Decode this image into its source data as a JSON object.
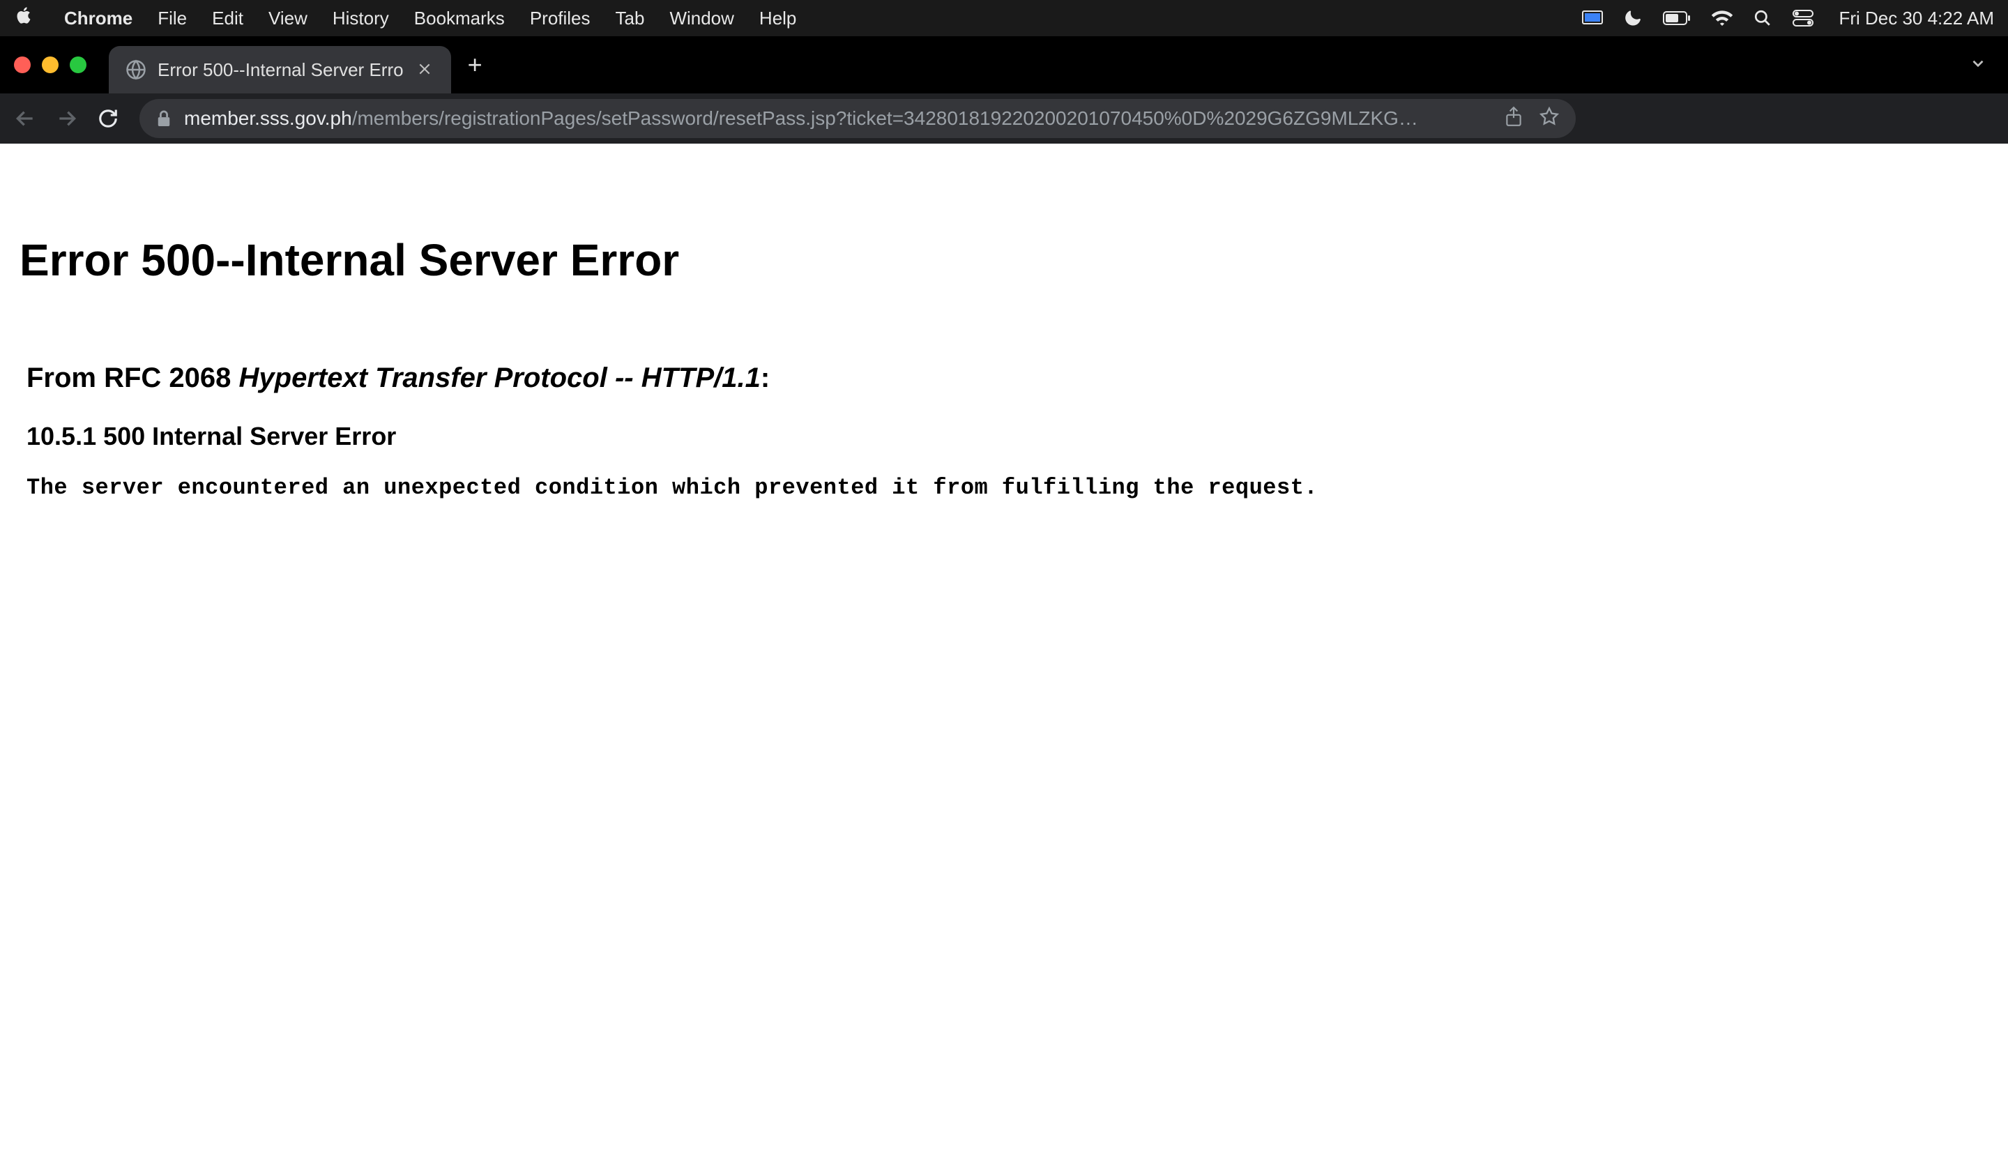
{
  "menubar": {
    "app_name": "Chrome",
    "items": [
      "File",
      "Edit",
      "View",
      "History",
      "Bookmarks",
      "Profiles",
      "Tab",
      "Window",
      "Help"
    ],
    "clock": "Fri Dec 30  4:22 AM"
  },
  "tab": {
    "title": "Error 500--Internal Server Erro"
  },
  "omnibox": {
    "domain": "member.sss.gov.ph",
    "path": "/members/registrationPages/setPassword/resetPass.jsp?ticket=342801819220200201070450%0D%2029G6ZG9MLZKG…"
  },
  "page": {
    "h1": "Error 500--Internal Server Error",
    "h2_prefix": "From RFC 2068 ",
    "h2_italic": "Hypertext Transfer Protocol -- HTTP/1.1",
    "h2_suffix": ":",
    "h3": "10.5.1 500 Internal Server Error",
    "body": "The server encountered an unexpected condition which prevented it from fulfilling the request."
  }
}
